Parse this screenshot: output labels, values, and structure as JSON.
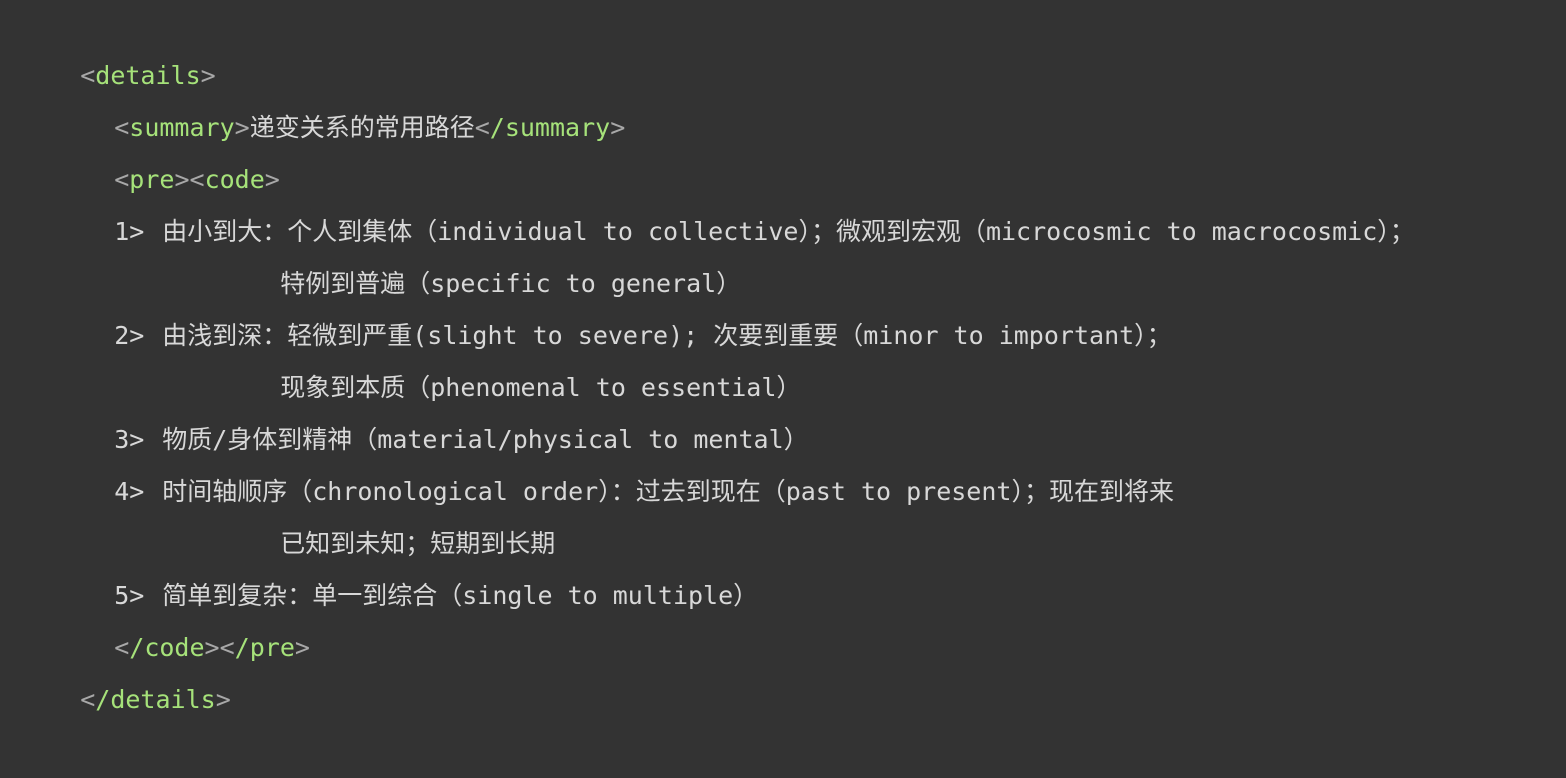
{
  "tags": {
    "open_details": "details",
    "open_summary": "summary",
    "close_summary": "/summary",
    "pre": "pre",
    "code": "code",
    "close_code": "/code",
    "close_pre": "/pre",
    "close_details": "/details"
  },
  "summary_text": "递变关系的常用路径",
  "items": [
    {
      "number": "1>",
      "line1": "由小到大：个人到集体（individual to collective）；微观到宏观（microcosmic to macrocosmic）；",
      "line2": "特例到普遍（specific to general）"
    },
    {
      "number": "2>",
      "line1": "由浅到深：轻微到严重(slight to severe); 次要到重要（minor to important）；",
      "line2": "现象到本质（phenomenal to essential）"
    },
    {
      "number": "3>",
      "line1": "物质/身体到精神（material/physical to mental）"
    },
    {
      "number": "4>",
      "line1": "时间轴顺序（chronological order）：过去到现在（past to present）；现在到将来",
      "line2": "已知到未知；短期到长期"
    },
    {
      "number": "5>",
      "line1": "简单到复杂：单一到综合（single to multiple）"
    }
  ]
}
